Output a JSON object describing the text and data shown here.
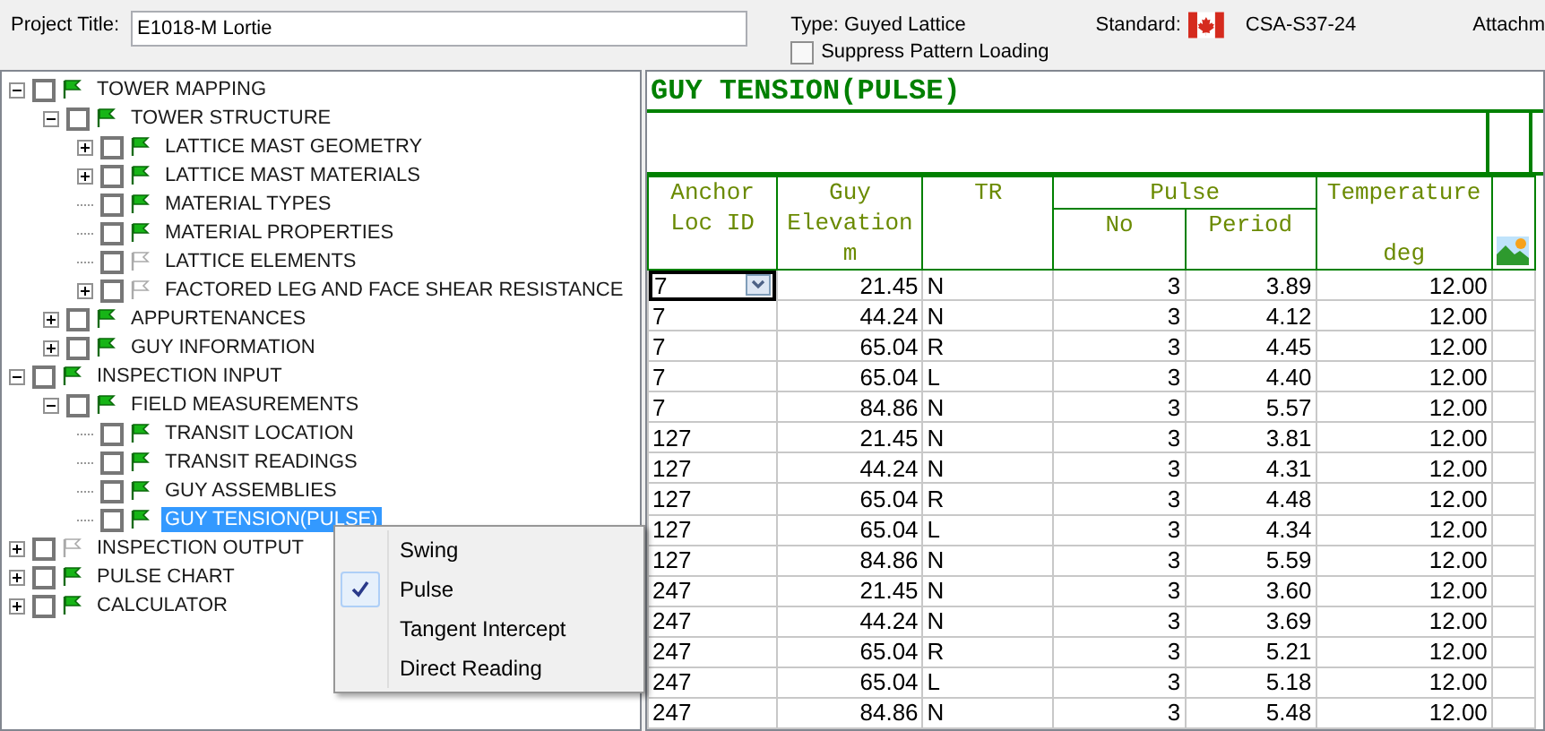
{
  "header": {
    "project_label": "Project Title:",
    "project_value": "E1018-M Lortie",
    "type_text": "Type: Guyed Lattice",
    "suppress": {
      "label": "Suppress Pattern Loading",
      "checked": false
    },
    "standard_label": "Standard:",
    "standard_value": "CSA-S37-24",
    "attach_label": "Attachm"
  },
  "tree": [
    {
      "label": "TOWER MAPPING",
      "done": true,
      "checked": false,
      "selected": false,
      "expanded": true,
      "children": [
        {
          "label": "TOWER STRUCTURE",
          "done": true,
          "checked": false,
          "selected": false,
          "expanded": true,
          "children": [
            {
              "label": "LATTICE MAST GEOMETRY",
              "done": true,
              "checked": false,
              "selected": false,
              "expanded": false
            },
            {
              "label": "LATTICE MAST MATERIALS",
              "done": true,
              "checked": false,
              "selected": false,
              "expanded": false
            },
            {
              "label": "MATERIAL TYPES",
              "done": true,
              "checked": false,
              "selected": false
            },
            {
              "label": "MATERIAL PROPERTIES",
              "done": true,
              "checked": false,
              "selected": false
            },
            {
              "label": "LATTICE ELEMENTS",
              "done": false,
              "checked": false,
              "selected": false
            },
            {
              "label": "FACTORED LEG AND FACE SHEAR RESISTANCE",
              "done": false,
              "checked": false,
              "selected": false,
              "expanded": false
            }
          ]
        },
        {
          "label": "APPURTENANCES",
          "done": true,
          "checked": false,
          "selected": false,
          "expanded": false
        },
        {
          "label": "GUY INFORMATION",
          "done": true,
          "checked": false,
          "selected": false,
          "expanded": false
        }
      ]
    },
    {
      "label": "INSPECTION INPUT",
      "done": true,
      "checked": false,
      "selected": false,
      "expanded": true,
      "children": [
        {
          "label": "FIELD MEASUREMENTS",
          "done": true,
          "checked": false,
          "selected": false,
          "expanded": true,
          "children": [
            {
              "label": "TRANSIT LOCATION",
              "done": true,
              "checked": false,
              "selected": false
            },
            {
              "label": "TRANSIT READINGS",
              "done": true,
              "checked": false,
              "selected": false
            },
            {
              "label": "GUY ASSEMBLIES",
              "done": true,
              "checked": false,
              "selected": false
            },
            {
              "label": "GUY TENSION(PULSE)",
              "done": true,
              "checked": false,
              "selected": true
            }
          ]
        }
      ]
    },
    {
      "label": "INSPECTION OUTPUT",
      "done": false,
      "checked": false,
      "selected": false,
      "expanded": false
    },
    {
      "label": "PULSE CHART",
      "done": true,
      "checked": false,
      "selected": false,
      "expanded": false
    },
    {
      "label": "CALCULATOR",
      "done": true,
      "checked": false,
      "selected": false,
      "expanded": false
    }
  ],
  "context_menu": [
    {
      "label": "Swing",
      "selected": false
    },
    {
      "label": "Pulse",
      "selected": true
    },
    {
      "label": "Tangent Intercept",
      "selected": false
    },
    {
      "label": "Direct Reading",
      "selected": false
    }
  ],
  "grid": {
    "title": "GUY TENSION(PULSE)",
    "columns": [
      {
        "label": "Anchor\nLoc ID"
      },
      {
        "label": "Guy\nElevation\nm"
      },
      {
        "label": "TR"
      },
      {
        "label": "Pulse",
        "colspan": 2,
        "children": [
          {
            "label": "No"
          },
          {
            "label": "Period"
          }
        ]
      },
      {
        "label": "Temperature\n\ndeg"
      }
    ],
    "rows": [
      {
        "editing": true,
        "cells": [
          "7",
          "21.45",
          "N",
          "3",
          "3.89",
          "12.00"
        ]
      },
      {
        "editing": false,
        "cells": [
          "7",
          "44.24",
          "N",
          "3",
          "4.12",
          "12.00"
        ]
      },
      {
        "editing": false,
        "cells": [
          "7",
          "65.04",
          "R",
          "3",
          "4.45",
          "12.00"
        ]
      },
      {
        "editing": false,
        "cells": [
          "7",
          "65.04",
          "L",
          "3",
          "4.40",
          "12.00"
        ]
      },
      {
        "editing": false,
        "cells": [
          "7",
          "84.86",
          "N",
          "3",
          "5.57",
          "12.00"
        ]
      },
      {
        "editing": false,
        "cells": [
          "127",
          "21.45",
          "N",
          "3",
          "3.81",
          "12.00"
        ]
      },
      {
        "editing": false,
        "cells": [
          "127",
          "44.24",
          "N",
          "3",
          "4.31",
          "12.00"
        ]
      },
      {
        "editing": false,
        "cells": [
          "127",
          "65.04",
          "R",
          "3",
          "4.48",
          "12.00"
        ]
      },
      {
        "editing": false,
        "cells": [
          "127",
          "65.04",
          "L",
          "3",
          "4.34",
          "12.00"
        ]
      },
      {
        "editing": false,
        "cells": [
          "127",
          "84.86",
          "N",
          "3",
          "5.59",
          "12.00"
        ]
      },
      {
        "editing": false,
        "cells": [
          "247",
          "21.45",
          "N",
          "3",
          "3.60",
          "12.00"
        ]
      },
      {
        "editing": false,
        "cells": [
          "247",
          "44.24",
          "N",
          "3",
          "3.69",
          "12.00"
        ]
      },
      {
        "editing": false,
        "cells": [
          "247",
          "65.04",
          "R",
          "3",
          "5.21",
          "12.00"
        ]
      },
      {
        "editing": false,
        "cells": [
          "247",
          "65.04",
          "L",
          "3",
          "5.18",
          "12.00"
        ]
      },
      {
        "editing": false,
        "cells": [
          "247",
          "84.86",
          "N",
          "3",
          "5.48",
          "12.00"
        ]
      }
    ]
  }
}
